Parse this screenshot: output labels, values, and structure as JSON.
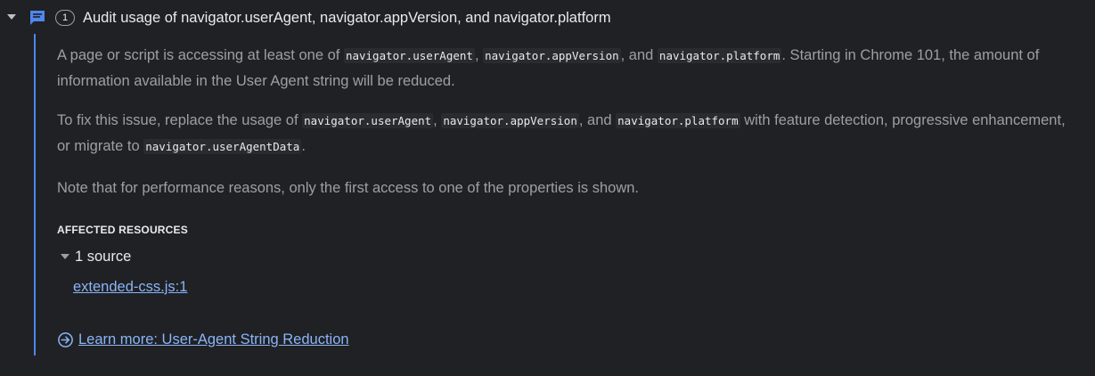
{
  "issue": {
    "count": "1",
    "title": "Audit usage of navigator.userAgent, navigator.appVersion, and navigator.platform",
    "icon": "message-icon",
    "accent_color": "#4e86ed"
  },
  "description": {
    "p1": {
      "t1": "A page or script is accessing at least one of ",
      "c1": "navigator.userAgent",
      "t2": ", ",
      "c2": "navigator.appVersion",
      "t3": ", and ",
      "c3": "navigator.platform",
      "t4": ". Starting in Chrome 101, the amount of information available in the User Agent string will be reduced."
    },
    "p2": {
      "t1": "To fix this issue, replace the usage of ",
      "c1": "navigator.userAgent",
      "t2": ", ",
      "c2": "navigator.appVersion",
      "t3": ", and ",
      "c3": "navigator.platform",
      "t4": " with feature detection, progressive enhancement, or migrate to ",
      "c4": "navigator.userAgentData",
      "t5": "."
    },
    "p3": "Note that for performance reasons, only the first access to one of the properties is shown."
  },
  "affected": {
    "header": "AFFECTED RESOURCES",
    "toggle_label": "1 source",
    "link": "extended-css.js:1"
  },
  "learn_more": {
    "label": "Learn more: User-Agent String Reduction",
    "icon": "arrow-circle-right-icon"
  }
}
